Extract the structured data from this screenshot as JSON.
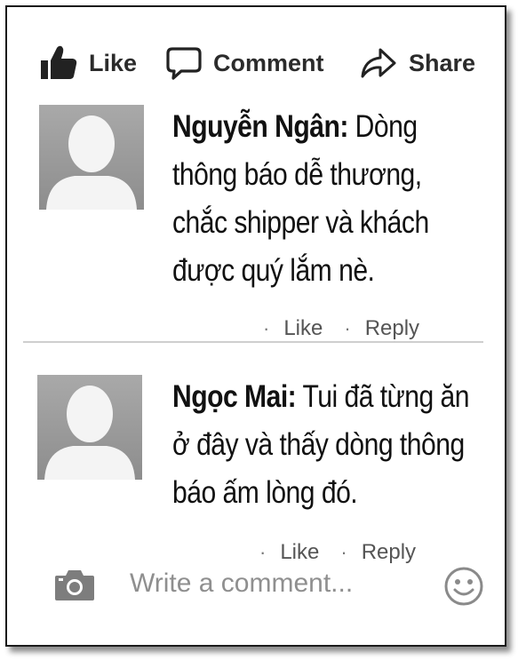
{
  "actions": {
    "like_label": "Like",
    "comment_label": "Comment",
    "share_label": "Share"
  },
  "comments": [
    {
      "author": "Nguyễn Ngân:",
      "text": " Dòng thông báo dễ thương, chắc shipper và khách được quý lắm nè.",
      "like_label": "Like",
      "reply_label": "Reply"
    },
    {
      "author": "Ngọc Mai:",
      "text": " Tui đã từng ăn ở đây và thấy dòng thông báo ấm lòng đó.",
      "like_label": "Like",
      "reply_label": "Reply"
    }
  ],
  "composer": {
    "placeholder": "Write a comment...",
    "camera_icon": "camera-icon",
    "emoji_icon": "smiley-icon"
  },
  "colors": {
    "border": "#1a1a1a",
    "avatar_bg": "#9a9a9a",
    "meta_text": "#555555",
    "placeholder_text": "#8f8f8f"
  }
}
